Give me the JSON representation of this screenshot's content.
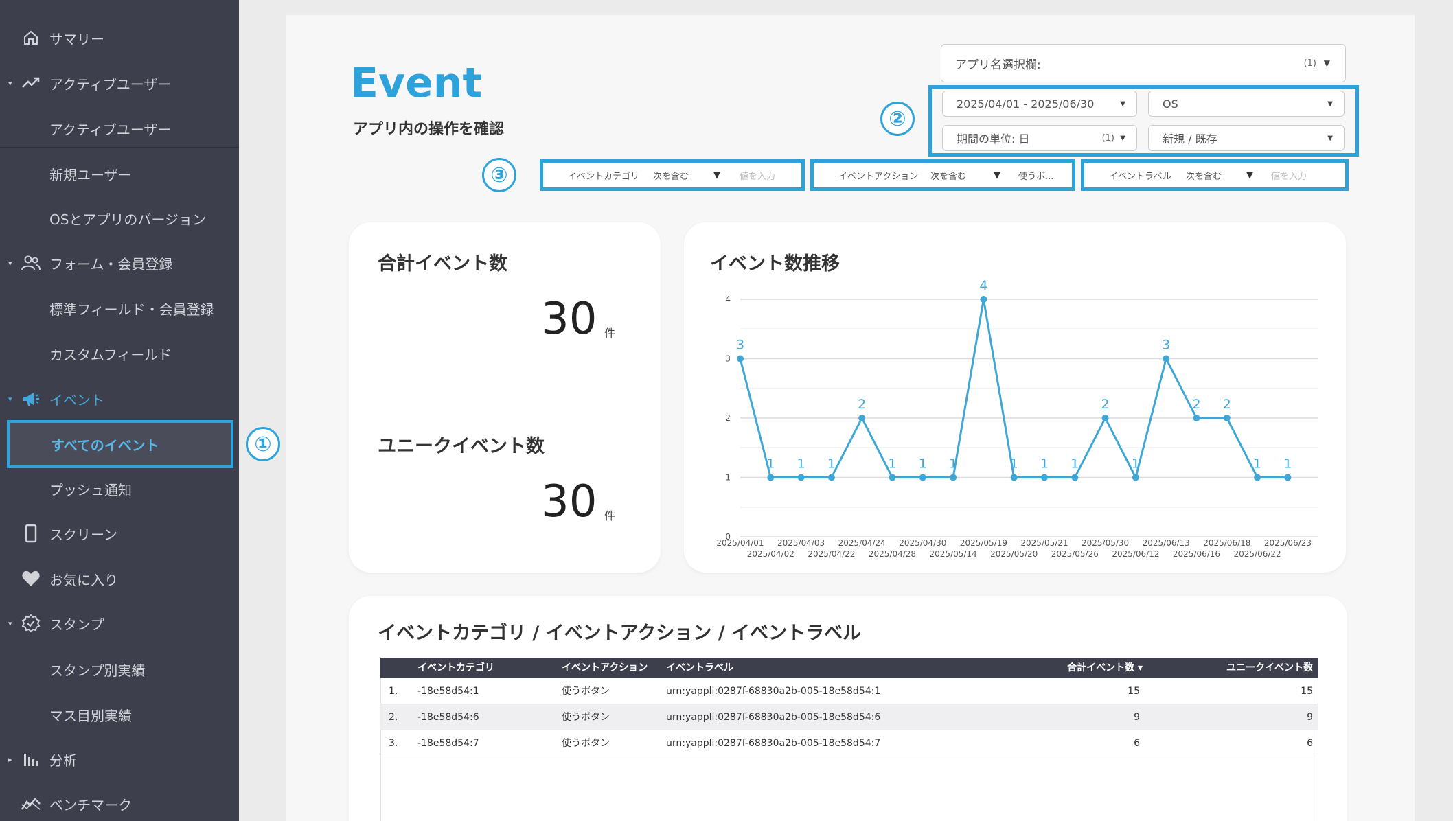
{
  "sidebar": {
    "items": [
      {
        "label": "サマリー",
        "icon": "home-icon"
      },
      {
        "label": "アクティブユーザー",
        "icon": "trend-icon"
      },
      {
        "label": "アクティブユーザー"
      },
      {
        "label": "新規ユーザー"
      },
      {
        "label": "OSとアプリのバージョン"
      },
      {
        "label": "フォーム・会員登録",
        "icon": "users-icon"
      },
      {
        "label": "標準フィールド・会員登録"
      },
      {
        "label": "カスタムフィールド"
      },
      {
        "label": "イベント",
        "icon": "megaphone-icon"
      },
      {
        "label": "すべてのイベント"
      },
      {
        "label": "プッシュ通知"
      },
      {
        "label": "スクリーン",
        "icon": "phone-icon"
      },
      {
        "label": "お気に入り",
        "icon": "heart-icon"
      },
      {
        "label": "スタンプ",
        "icon": "badge-icon"
      },
      {
        "label": "スタンプ別実績"
      },
      {
        "label": "マス目別実績"
      },
      {
        "label": "分析",
        "icon": "bar-chart-icon"
      },
      {
        "label": "ベンチマーク",
        "icon": "benchmark-icon"
      }
    ]
  },
  "annotations": {
    "one": "①",
    "two": "②",
    "three": "③"
  },
  "header": {
    "title": "Event",
    "subtitle": "アプリ内の操作を確認"
  },
  "controls": {
    "app_select": {
      "label": "アプリ名選択欄:",
      "count": "(1)"
    },
    "date_range": "2025/04/01 - 2025/06/30",
    "os": "OS",
    "period_unit": {
      "label": "期間の単位: 日",
      "count": "(1)"
    },
    "new_existing": "新規 / 既存"
  },
  "filters": [
    {
      "label": "イベントカテゴリ",
      "op": "次を含む",
      "value": "値を入力"
    },
    {
      "label": "イベントアクション",
      "op": "次を含む",
      "value": "使うボ..."
    },
    {
      "label": "イベントラベル",
      "op": "次を含む",
      "value": "値を入力"
    }
  ],
  "kpi": {
    "total_title": "合計イベント数",
    "total_value": "30",
    "total_unit": "件",
    "unique_title": "ユニークイベント数",
    "unique_value": "30",
    "unique_unit": "件"
  },
  "chart_data": {
    "type": "line",
    "title": "イベント数推移",
    "x": [
      "2025/04/01",
      "2025/04/02",
      "2025/04/03",
      "2025/04/22",
      "2025/04/24",
      "2025/04/28",
      "2025/04/30",
      "2025/05/14",
      "2025/05/19",
      "2025/05/20",
      "2025/05/21",
      "2025/05/26",
      "2025/05/30",
      "2025/06/12",
      "2025/06/13",
      "2025/06/16",
      "2025/06/18",
      "2025/06/22",
      "2025/06/23"
    ],
    "series": [
      {
        "values": [
          3,
          1,
          1,
          1,
          2,
          1,
          1,
          1,
          4,
          1,
          1,
          1,
          2,
          1,
          3,
          2,
          2,
          1,
          1
        ]
      }
    ],
    "ylim": [
      0,
      4
    ],
    "yticks": [
      0,
      1,
      2,
      3,
      4
    ],
    "color": "#3fa6d6",
    "grid": true
  },
  "table": {
    "title": "イベントカテゴリ / イベントアクション / イベントラベル",
    "columns": [
      "イベントカテゴリ",
      "イベントアクション",
      "イベントラベル",
      "合計イベント数 ▾",
      "ユニークイベント数"
    ],
    "rows": [
      {
        "no": "1.",
        "category": "-18e58d54:1",
        "action": "使うボタン",
        "label": "urn:yappli:0287f-68830a2b-005-18e58d54:1",
        "total": "15",
        "unique": "15"
      },
      {
        "no": "2.",
        "category": "-18e58d54:6",
        "action": "使うボタン",
        "label": "urn:yappli:0287f-68830a2b-005-18e58d54:6",
        "total": "9",
        "unique": "9"
      },
      {
        "no": "3.",
        "category": "-18e58d54:7",
        "action": "使うボタン",
        "label": "urn:yappli:0287f-68830a2b-005-18e58d54:7",
        "total": "6",
        "unique": "6"
      }
    ]
  }
}
